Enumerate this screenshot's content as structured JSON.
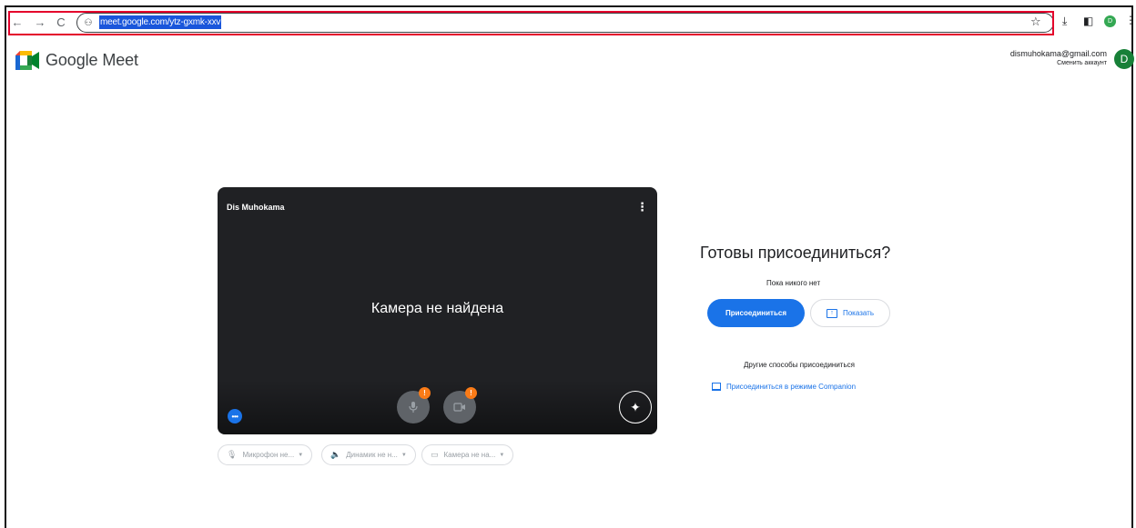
{
  "browser": {
    "back_label": "←",
    "forward_label": "→",
    "reload_label": "C",
    "site_info_label": "⚇",
    "url": "meet.google.com/ytz-gxmk-xxv",
    "star_label": "☆",
    "download_label": "⤓",
    "sidepanel_label": "◧",
    "profile_label": "D",
    "menu_label": "⋮"
  },
  "header": {
    "brand": "Google Meet",
    "account_email": "dismuhokama@gmail.com",
    "switch_account": "Сменить аккаунт",
    "avatar_letter": "D"
  },
  "preview": {
    "self_name": "Dis Muhokama",
    "no_camera_text": "Камера не найдена",
    "warning_mark": "!",
    "menu_label": "⋮",
    "more_label": "•••",
    "effects_label": "✦"
  },
  "devices": [
    {
      "icon": "🎙",
      "label": "Микрофон не..."
    },
    {
      "icon": "🔈",
      "label": "Динамик не н..."
    },
    {
      "icon": "▭",
      "label": "Камера не на..."
    }
  ],
  "join": {
    "title": "Готовы присоединиться?",
    "status": "Пока никого нет",
    "join_button": "Присоединиться",
    "present_button": "Показать",
    "other_ways": "Другие способы присоединиться",
    "companion_link": "Присоединиться в режиме Companion"
  },
  "colors": {
    "accent": "#1a73e8",
    "highlight_box": "#e4002b",
    "preview_bg": "#202124",
    "warning": "#fa7b17",
    "avatar": "#188038"
  }
}
